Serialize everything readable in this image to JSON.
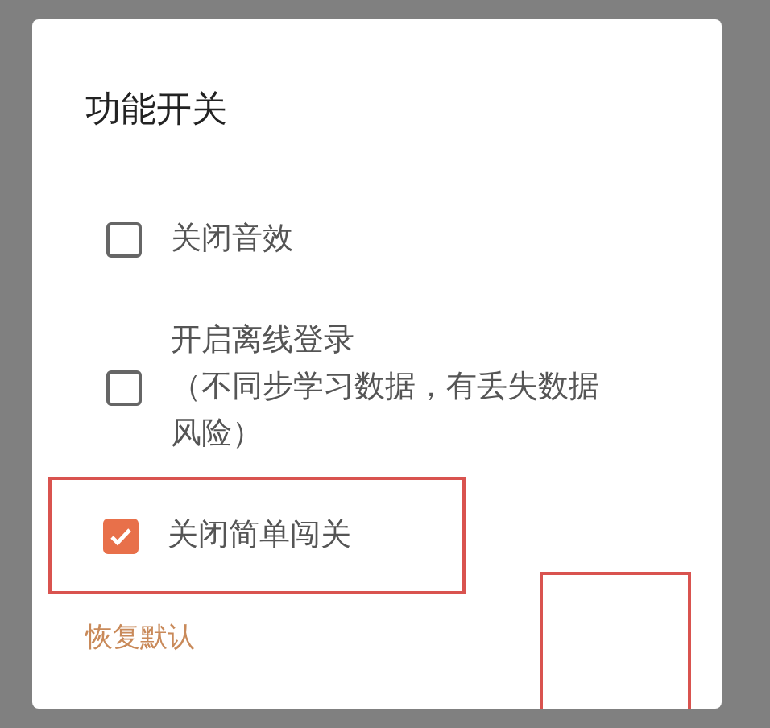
{
  "dialog": {
    "title": "功能开关",
    "options": [
      {
        "lines": [
          "关闭音效"
        ],
        "checked": false,
        "highlighted": false
      },
      {
        "lines": [
          "开启离线登录",
          "（不同步学习数据，有丢失数据",
          "风险）"
        ],
        "checked": false,
        "highlighted": false
      },
      {
        "lines": [
          "关闭简单闯关"
        ],
        "checked": true,
        "highlighted": true
      }
    ],
    "reset_link": "恢复默认",
    "confirm_highlighted": true
  }
}
